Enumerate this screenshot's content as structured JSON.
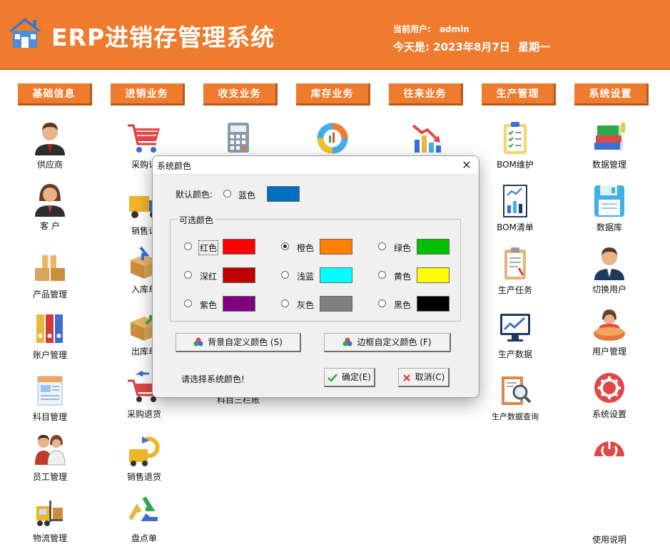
{
  "header": {
    "title": "ERP进销存管理系统",
    "user_label": "当前用户:",
    "user_name": "admin",
    "date_text": "今天是:  2023年8月7日",
    "weekday": "星期一"
  },
  "tabs": [
    "基础信息",
    "进销业务",
    "收支业务",
    "库存业务",
    "往来业务",
    "生产管理",
    "系统设置"
  ],
  "columns": {
    "col1": [
      "供应商",
      "客  户",
      "产品管理",
      "账户管理",
      "科目管理",
      "员工管理",
      "物流管理"
    ],
    "col2": [
      "采购订",
      "销售订",
      "入库单",
      "出库单",
      "采购退货",
      "销售退货",
      "盘点单"
    ],
    "col3": [
      "科目三栏账"
    ],
    "col6": [
      "BOM维护",
      "BOM清单",
      "生产任务",
      "生产数据",
      "生产数据查询"
    ],
    "col7": [
      "数据管理",
      "数据库",
      "切换用户",
      "用户管理",
      "系统设置",
      "使用说明"
    ]
  },
  "dialog": {
    "title": "系统颜色",
    "default_label": "默认颜色:",
    "default_option": "蓝色",
    "group_label": "可选颜色",
    "options": [
      {
        "label": "红色",
        "color": "#ff0000",
        "selected": false
      },
      {
        "label": "橙色",
        "color": "#ff8000",
        "selected": true
      },
      {
        "label": "绿色",
        "color": "#00c000",
        "selected": false
      },
      {
        "label": "深红",
        "color": "#c00000",
        "selected": false
      },
      {
        "label": "浅蓝",
        "color": "#00ffff",
        "selected": false
      },
      {
        "label": "黄色",
        "color": "#ffff00",
        "selected": false
      },
      {
        "label": "紫色",
        "color": "#800080",
        "selected": false
      },
      {
        "label": "灰色",
        "color": "#808080",
        "selected": false
      },
      {
        "label": "黑色",
        "color": "#000000",
        "selected": false
      }
    ],
    "default_color": "#0070c0",
    "bg_button": "背景自定义颜色 (S)",
    "border_button": "边框自定义颜色 (F)",
    "hint": "请选择系统颜色!",
    "ok_button": "确定(E)",
    "cancel_button": "取消(C)"
  },
  "colors": {
    "accent": "#ee7b2e",
    "accent_shadow": "#b65a1c"
  }
}
